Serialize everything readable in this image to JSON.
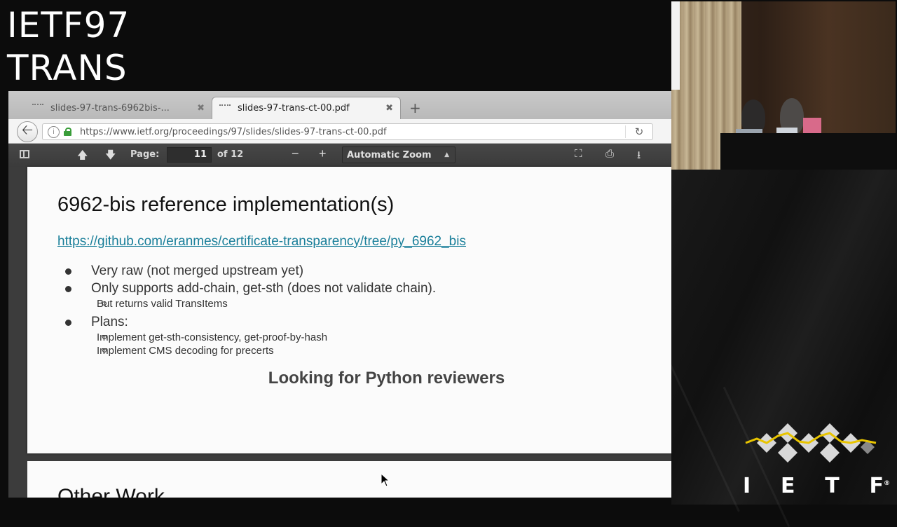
{
  "overlay": {
    "line1": "IETF97",
    "line2": "TRANS"
  },
  "browser": {
    "tabs": [
      {
        "label": "slides-97-trans-6962bis-...",
        "active": false
      },
      {
        "label": "slides-97-trans-ct-00.pdf",
        "active": true
      }
    ],
    "url": "https://www.ietf.org/proceedings/97/slides/slides-97-trans-ct-00.pdf"
  },
  "pdf_toolbar": {
    "page_label": "Page:",
    "page_value": "11",
    "page_of": "of 12",
    "zoom": "Automatic Zoom",
    "zoom_minus": "−",
    "zoom_plus": "+"
  },
  "slide": {
    "title": "6962-bis reference implementation(s)",
    "link": "https://github.com/eranmes/certificate-transparency/tree/py_6962_bis",
    "bullets": [
      {
        "text": "Very raw (not merged upstream yet)"
      },
      {
        "text": "Only supports add-chain, get-sth (does not validate chain).",
        "sub": [
          "But returns valid TransItems"
        ]
      },
      {
        "text": "Plans:",
        "sub": [
          "Implement get-sth-consistency, get-proof-by-hash",
          "Implement CMS decoding for precerts"
        ]
      }
    ],
    "callout": "Looking for Python reviewers",
    "next_slide_title_partial": "Other Work"
  },
  "logo": {
    "letters": [
      "I",
      "E",
      "T",
      "F"
    ],
    "registered": "®",
    "colors": {
      "diamond": "#d8d8d8",
      "wave": "#e8c400"
    }
  },
  "icons": [
    "back-arrow-icon",
    "info-icon",
    "lock-icon",
    "reload-icon",
    "sidebar-toggle-icon",
    "page-up-icon",
    "page-down-icon",
    "fullscreen-icon",
    "print-icon",
    "download-icon",
    "tab-close-icon",
    "new-tab-icon",
    "mouse-cursor-icon"
  ]
}
